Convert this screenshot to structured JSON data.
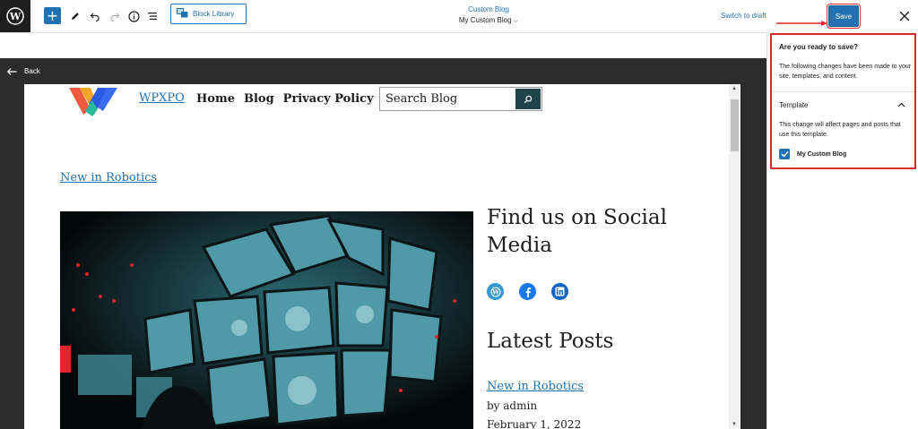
{
  "toolbar": {
    "block_library_label": "Block Library",
    "save_label": "Save",
    "switch_to_draft": "Switch to draft"
  },
  "document": {
    "type_label": "Custom Blog",
    "template_name": "My Custom Blog"
  },
  "editor": {
    "back_label": "Back"
  },
  "site": {
    "title": "WPXPO",
    "nav": [
      "Home",
      "Blog",
      "Privacy Policy"
    ],
    "search_placeholder": "Search Blog"
  },
  "content": {
    "post_link": "New in Robotics",
    "social_heading": "Find us on Social Media",
    "latest_heading": "Latest Posts",
    "latest_post_title": "New in Robotics",
    "latest_post_author": "by admin",
    "latest_post_date": "February 1, 2022"
  },
  "save_panel": {
    "title": "Are you ready to save?",
    "description": "The following changes have been made to your site, templates, and content.",
    "section_title": "Template",
    "section_description": "This change will affect pages and posts that use this template.",
    "checkbox_label": "My Custom Blog",
    "checkbox_checked": true
  },
  "colors": {
    "accent": "#2271b1",
    "highlight": "#e0262c",
    "dark": "#1e1e1e"
  }
}
